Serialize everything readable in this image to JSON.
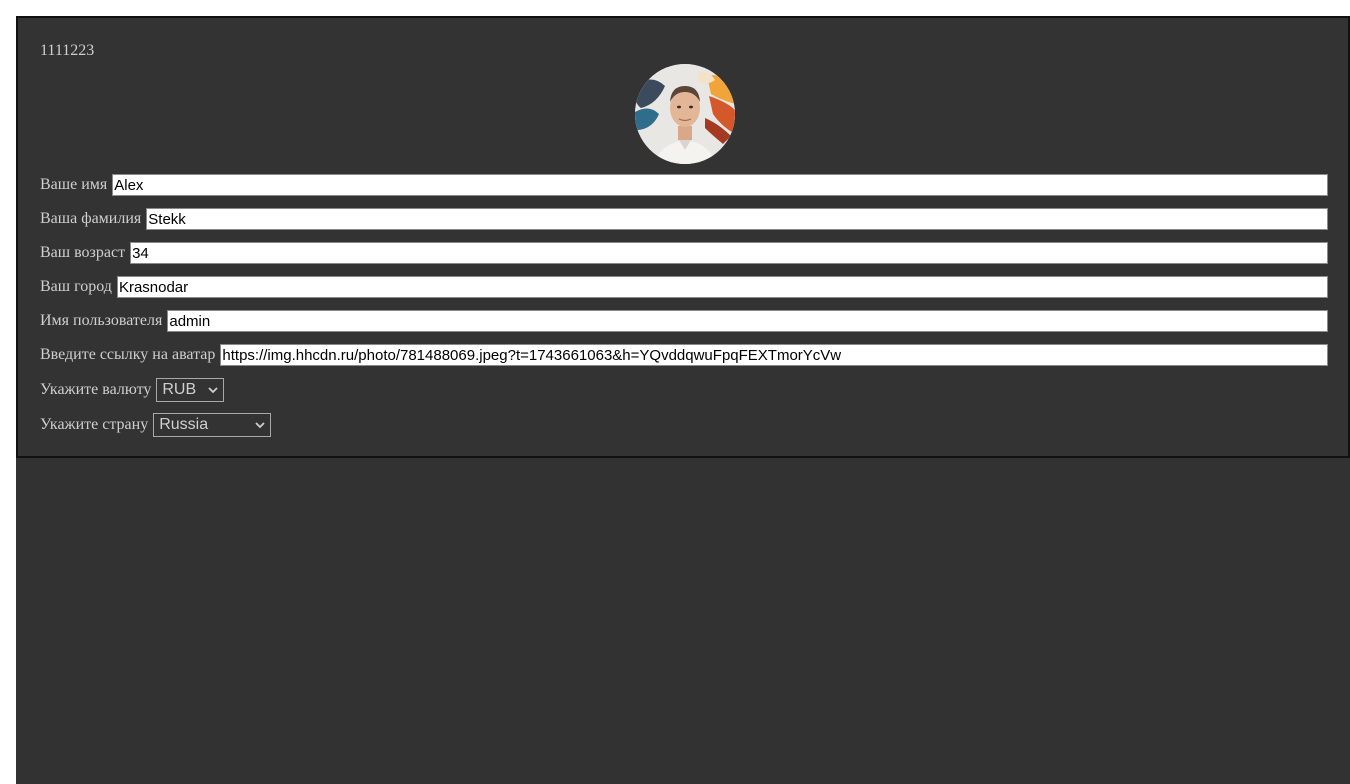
{
  "profile": {
    "user_id": "1111223",
    "avatar_alt": "avatar"
  },
  "form": {
    "first_name": {
      "label": "Ваше имя",
      "value": "Alex"
    },
    "last_name": {
      "label": "Ваша фамилия",
      "value": "Stekk"
    },
    "age": {
      "label": "Ваш возраст",
      "value": "34"
    },
    "city": {
      "label": "Ваш город",
      "value": "Krasnodar"
    },
    "username": {
      "label": "Имя пользователя",
      "value": "admin"
    },
    "avatar_url": {
      "label": "Введите ссылку на аватар",
      "value": "https://img.hhcdn.ru/photo/781488069.jpeg?t=1743661063&h=YQvddqwuFpqFEXTmorYcVw"
    },
    "currency": {
      "label": "Укажите валюту",
      "value": "RUB"
    },
    "country": {
      "label": "Укажите страну",
      "value": "Russia"
    }
  },
  "colors": {
    "panel_bg": "#333333",
    "text": "#cfcfcf"
  },
  "icons": {
    "select_arrow": "chevron-down-icon"
  }
}
